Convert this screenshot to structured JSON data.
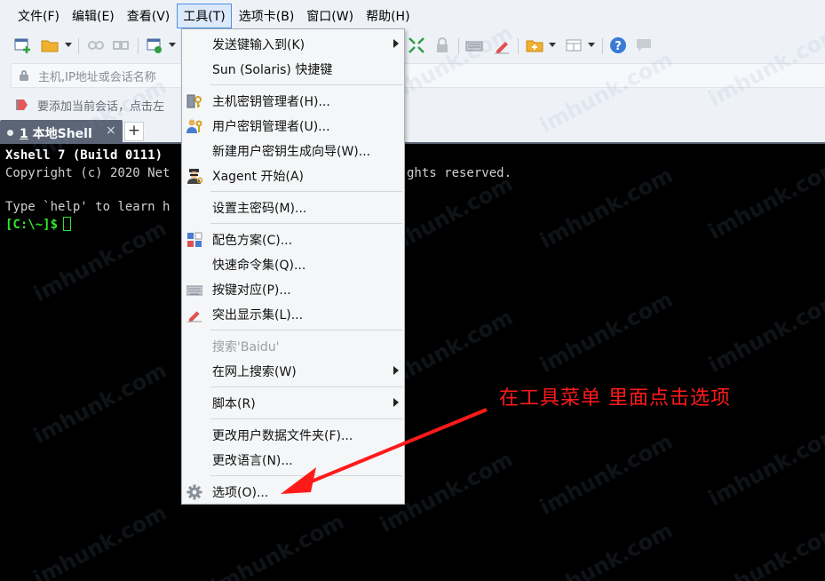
{
  "menubar": {
    "items": [
      "文件(F)",
      "编辑(E)",
      "查看(V)",
      "工具(T)",
      "选项卡(B)",
      "窗口(W)",
      "帮助(H)"
    ]
  },
  "addressbar": {
    "placeholder": "主机,IP地址或会话名称"
  },
  "hintbar": {
    "text": "要添加当前会话，点击左"
  },
  "tabs": {
    "active_number": "1",
    "active_label": " 本地Shell",
    "close": "×",
    "add": "+"
  },
  "terminal": {
    "line1_a": "Xshell 7 (Build 0111)",
    "line2_a": "Copyright (c) 2020 Net",
    "line2_b": "ghts reserved.",
    "line4_a": "Type `help' to learn h",
    "prompt": "[C:\\~]$"
  },
  "tools_menu": {
    "items": [
      {
        "label": "发送键输入到(K)",
        "submenu": true
      },
      {
        "label": "Sun (Solaris) 快捷键"
      },
      {
        "label": "主机密钥管理者(H)...",
        "icon": "host-key-icon"
      },
      {
        "label": "用户密钥管理者(U)...",
        "icon": "user-key-icon"
      },
      {
        "label": "新建用户密钥生成向导(W)..."
      },
      {
        "label": "Xagent 开始(A)",
        "icon": "xagent-icon"
      },
      {
        "label": "设置主密码(M)..."
      },
      {
        "label": "配色方案(C)...",
        "icon": "color-scheme-icon"
      },
      {
        "label": "快速命令集(Q)..."
      },
      {
        "label": "按键对应(P)...",
        "icon": "keyboard-icon"
      },
      {
        "label": "突出显示集(L)...",
        "icon": "highlight-pen-icon"
      },
      {
        "label": "搜索'Baidu'",
        "disabled": true
      },
      {
        "label": "在网上搜索(W)",
        "submenu": true
      },
      {
        "label": "脚本(R)",
        "submenu": true
      },
      {
        "label": "更改用户数据文件夹(F)..."
      },
      {
        "label": "更改语言(N)..."
      },
      {
        "label": "选项(O)...",
        "icon": "gear-icon"
      }
    ]
  },
  "annotation": {
    "text": "在工具菜单 里面点击选项"
  },
  "watermark": "imhunk.com",
  "colors": {
    "menu_bg": "#eef2f7",
    "tab_bg": "#5b6575",
    "prompt_green": "#2ee62e",
    "annotation_red": "#ff1a1a"
  }
}
